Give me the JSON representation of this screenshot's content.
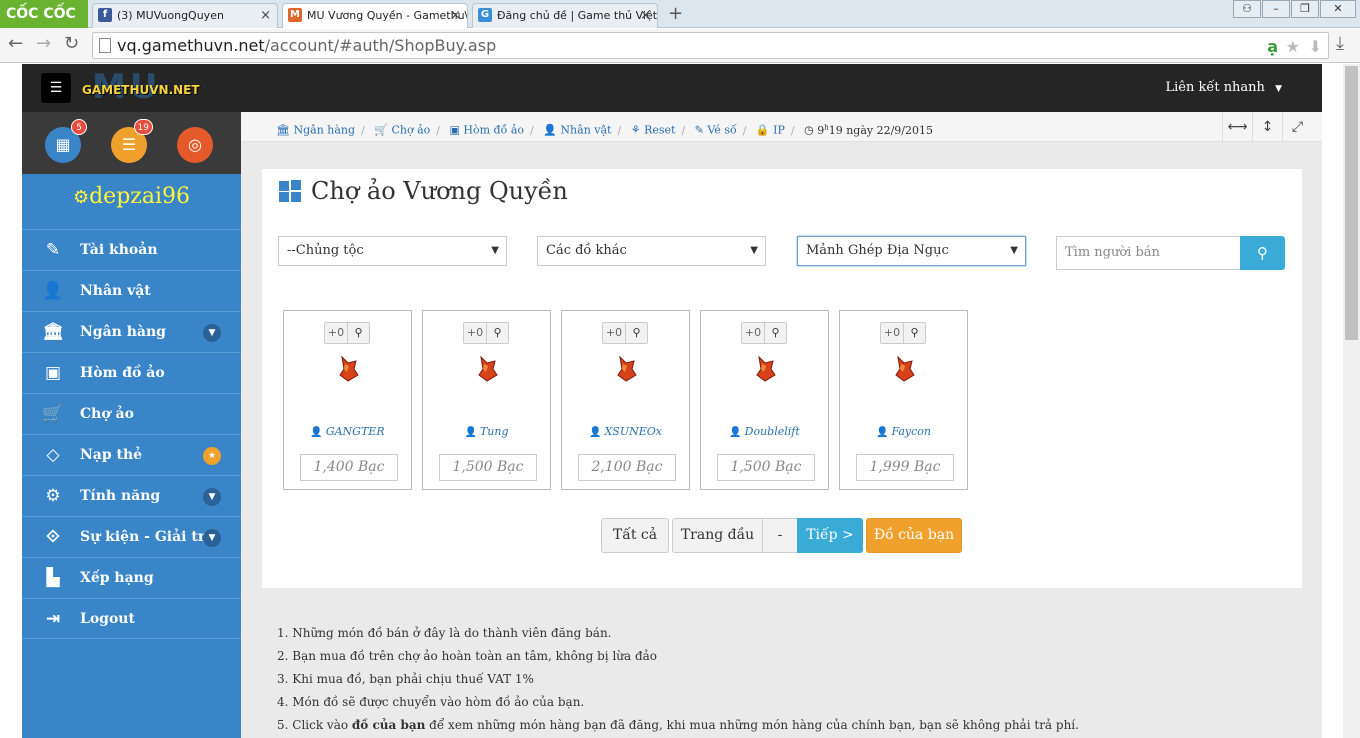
{
  "browser": {
    "brand": "CỐC CỐC",
    "tabs": [
      {
        "label": "(3) MUVuongQuyen",
        "fav": "f",
        "favcolor": "#3b5998"
      },
      {
        "label": "MU Vương Quyền - Gamethu\\",
        "fav": "M",
        "favcolor": "#e0672b"
      },
      {
        "label": "Đăng chủ đề | Game thủ Việt",
        "fav": "G",
        "favcolor": "#3a8fd8"
      }
    ],
    "url_host": "vq.gamethuvn.net",
    "url_path": "/account/#auth/ShopBuy.asp"
  },
  "site": {
    "logo_mu": "MU",
    "logo_text": "GAMETHUVN.NET",
    "quick_links": "Liên kết nhanh",
    "sidebar_badges": [
      "5",
      "19"
    ],
    "username": "depzai96",
    "menu": [
      {
        "label": "Tài khoản",
        "icon": "edit-icon"
      },
      {
        "label": "Nhân vật",
        "icon": "user-icon"
      },
      {
        "label": "Ngân hàng",
        "icon": "bank-icon"
      },
      {
        "label": "Hòm đồ ảo",
        "icon": "briefcase-icon"
      },
      {
        "label": "Chợ ảo",
        "icon": "cart-icon"
      },
      {
        "label": "Nạp thẻ",
        "icon": "diamond-icon"
      },
      {
        "label": "Tính năng",
        "icon": "gears-icon"
      },
      {
        "label": "Sự kiện - Giải trí",
        "icon": "link-icon"
      },
      {
        "label": "Xếp hạng",
        "icon": "bar-chart-icon"
      },
      {
        "label": "Logout",
        "icon": "logout-icon"
      }
    ],
    "breadcrumb": [
      "Ngân hàng",
      "Chợ ảo",
      "Hòm đồ ảo",
      "Nhân vật",
      "Reset",
      "Vé số",
      "IP"
    ],
    "time_hour": "9",
    "time_rest": "19 ngày 22/9/2015",
    "page_title": "Chợ ảo Vương Quyền",
    "filters": [
      "--Chủng tộc",
      "Các đồ khác",
      "Mảnh Ghép Địa Ngục"
    ],
    "search_placeholder": "Tìm người bán",
    "items": [
      {
        "plus": "+0",
        "seller": "GANGTER",
        "price": "1,400 Bạc"
      },
      {
        "plus": "+0",
        "seller": "Tung",
        "price": "1,500 Bạc"
      },
      {
        "plus": "+0",
        "seller": "XSUNEOx",
        "price": "2,100 Bạc"
      },
      {
        "plus": "+0",
        "seller": "Doublelift",
        "price": "1,500 Bạc"
      },
      {
        "plus": "+0",
        "seller": "Faycon",
        "price": "1,999 Bạc"
      }
    ],
    "pagination": {
      "all": "Tất cả",
      "first": "Trang đầu",
      "dash": "-",
      "next": "Tiếp >",
      "mine": "Đồ của bạn"
    },
    "notes": [
      "1. Những món đồ bán ở đây là do thành viên đăng bán.",
      "2. Bạn mua đồ trên chợ ảo hoàn toàn an tâm, không bị lừa đảo",
      "3. Khi mua đồ, bạn phải chịu thuế VAT 1%",
      "4. Món đồ sẽ được chuyển vào hòm đồ ảo của bạn."
    ],
    "note5_pre": "5. Click vào ",
    "note5_bold": "đồ của bạn",
    "note5_post": " để xem những món hàng bạn đã đăng, khi mua những món hàng của chính bạn, bạn sẽ không phải trả phí."
  }
}
